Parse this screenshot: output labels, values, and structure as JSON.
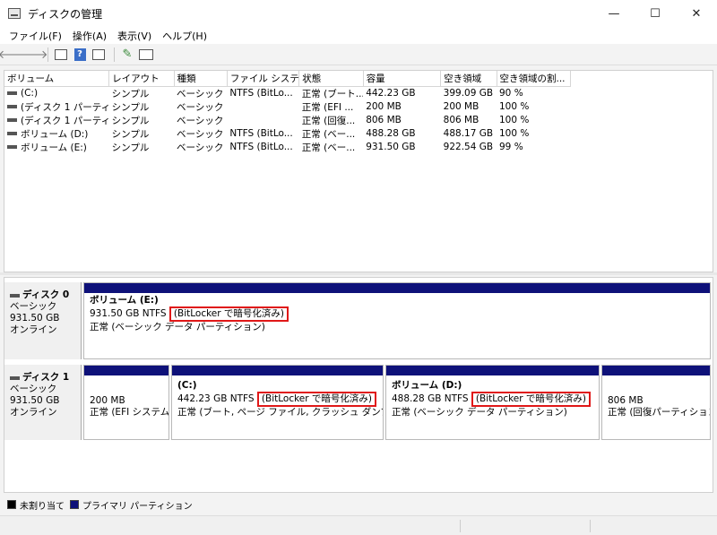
{
  "window": {
    "title": "ディスクの管理",
    "minimize": "—",
    "maximize": "☐",
    "close": "✕"
  },
  "menu": [
    "ファイル(F)",
    "操作(A)",
    "表示(V)",
    "ヘルプ(H)"
  ],
  "toolbar": {
    "icons": [
      "back-arrow-icon",
      "forward-arrow-icon",
      "properties-icon",
      "help-icon",
      "view-icon",
      "connect-icon",
      "rescan-icon"
    ]
  },
  "volume_table": {
    "columns": [
      "ボリューム",
      "レイアウト",
      "種類",
      "ファイル システム",
      "状態",
      "容量",
      "空き領域",
      "空き領域の割..."
    ],
    "rows": [
      [
        "(C:)",
        "シンプル",
        "ベーシック",
        "NTFS (BitLo...",
        "正常 (ブート...",
        "442.23 GB",
        "399.09 GB",
        "90 %"
      ],
      [
        "(ディスク 1 パーティシ...",
        "シンプル",
        "ベーシック",
        "",
        "正常 (EFI ...",
        "200 MB",
        "200 MB",
        "100 %"
      ],
      [
        "(ディスク 1 パーティシ...",
        "シンプル",
        "ベーシック",
        "",
        "正常 (回復...",
        "806 MB",
        "806 MB",
        "100 %"
      ],
      [
        "ボリューム (D:)",
        "シンプル",
        "ベーシック",
        "NTFS (BitLo...",
        "正常 (ベー...",
        "488.28 GB",
        "488.17 GB",
        "100 %"
      ],
      [
        "ボリューム (E:)",
        "シンプル",
        "ベーシック",
        "NTFS (BitLo...",
        "正常 (ベー...",
        "931.50 GB",
        "922.54 GB",
        "99 %"
      ]
    ]
  },
  "disks": [
    {
      "name": "ディスク 0",
      "type": "ベーシック",
      "size": "931.50 GB",
      "status": "オンライン",
      "partitions": [
        {
          "name": "ボリューム (E:)",
          "size": "931.50 GB NTFS",
          "encryption": "(BitLocker で暗号化済み)",
          "status": "正常 (ベーシック データ パーティション)"
        }
      ]
    },
    {
      "name": "ディスク 1",
      "type": "ベーシック",
      "size": "931.50 GB",
      "status": "オンライン",
      "partitions": [
        {
          "name": "",
          "size": "200 MB",
          "encryption": "",
          "status": "正常 (EFI システム"
        },
        {
          "name": "(C:)",
          "size": "442.23 GB NTFS",
          "encryption": "(BitLocker で暗号化済み)",
          "status": "正常 (ブート, ページ ファイル, クラッシュ ダンプ, ベーシ"
        },
        {
          "name": "ボリューム (D:)",
          "size": "488.28 GB NTFS",
          "encryption": "(BitLocker で暗号化済み)",
          "status": "正常 (ベーシック データ パーティション)"
        },
        {
          "name": "",
          "size": "806 MB",
          "encryption": "",
          "status": "正常 (回復パーティション)"
        }
      ]
    }
  ],
  "legend": [
    {
      "label": "未割り当て",
      "color": "#000000"
    },
    {
      "label": "プライマリ パーティション",
      "color": "#0e1179"
    }
  ],
  "colors": {
    "partition_header": "#0e1179",
    "highlight": "#e01818"
  }
}
